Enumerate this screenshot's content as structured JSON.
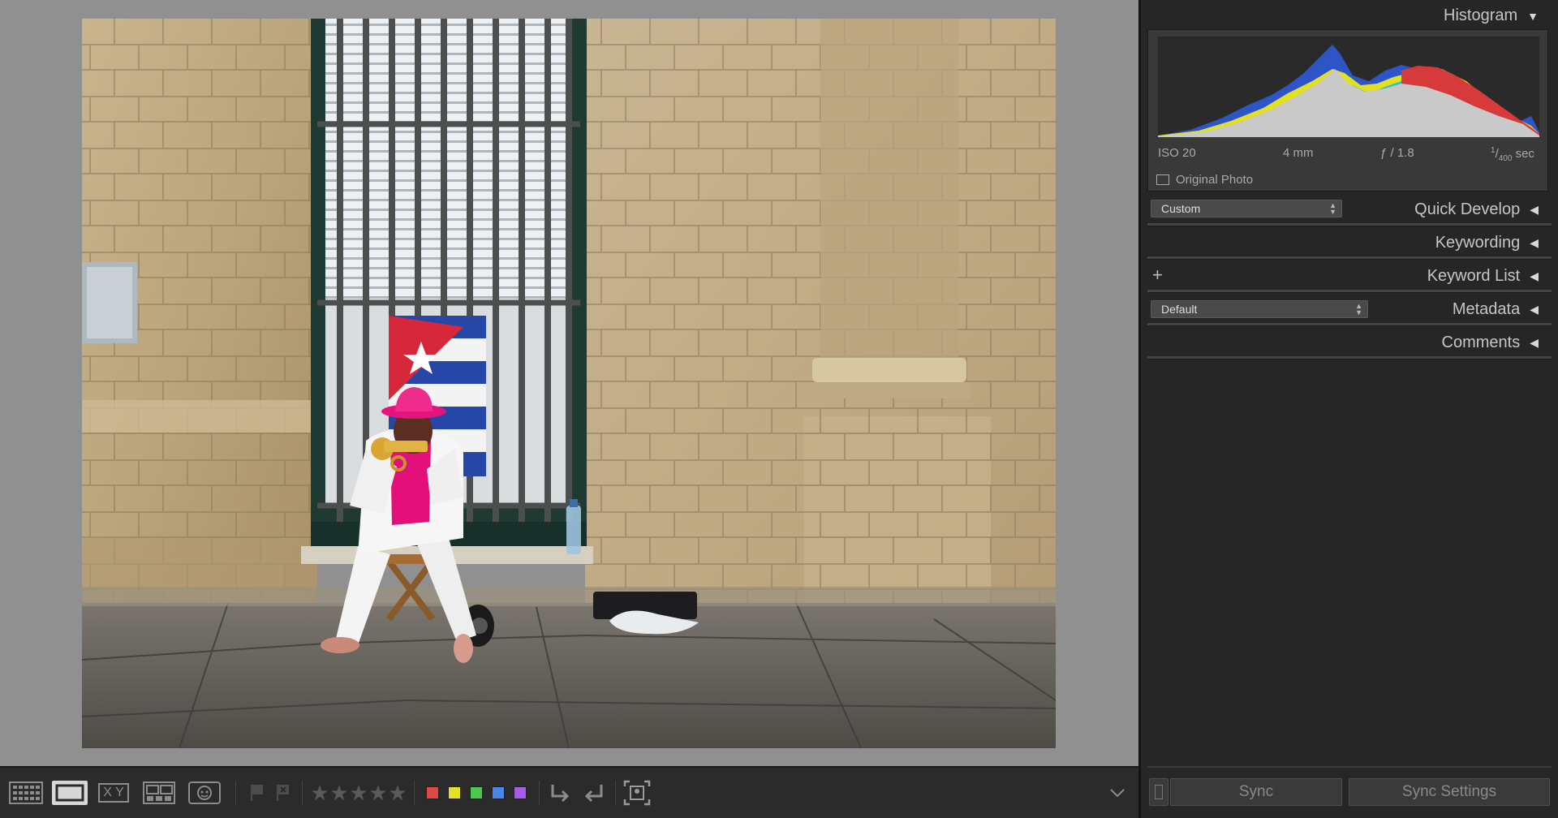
{
  "right_panel": {
    "histogram": {
      "title": "Histogram",
      "iso": "ISO 20",
      "focal": "4 mm",
      "aperture": "ƒ / 1.8",
      "shutter_num": "1",
      "shutter_den": "400",
      "shutter_unit": "sec",
      "original_photo_label": "Original Photo"
    },
    "quick_develop": {
      "title": "Quick Develop",
      "preset": "Custom"
    },
    "keywording": {
      "title": "Keywording"
    },
    "keyword_list": {
      "title": "Keyword List",
      "add_symbol": "+"
    },
    "metadata": {
      "title": "Metadata",
      "preset": "Default"
    },
    "comments": {
      "title": "Comments"
    },
    "sync_label": "Sync",
    "sync_settings_label": "Sync Settings"
  },
  "toolbar": {
    "survey_letters": "X Y",
    "star_glyph": "★",
    "color_labels": [
      "#e04848",
      "#e6df2a",
      "#4ec74e",
      "#4a86e8",
      "#a45ee5"
    ]
  },
  "colors": {
    "panel_bg": "#262626",
    "center_bg": "#909090",
    "toolbar_bg": "#2b2b2b"
  },
  "icons": {
    "grid": "grid-view-icon",
    "loupe": "loupe-view-icon",
    "compare": "compare-view-icon",
    "survey": "survey-view-icon",
    "people": "people-view-icon",
    "flag_pick": "flag-pick-icon",
    "flag_reject": "flag-reject-icon",
    "rotate_left": "rotate-left-icon",
    "rotate_right": "rotate-right-icon",
    "crop": "crop-overlay-icon",
    "toolbar_menu": "toolbar-menu-chevron-icon",
    "panel_collapse": "panel-collapse-triangle-icon"
  }
}
